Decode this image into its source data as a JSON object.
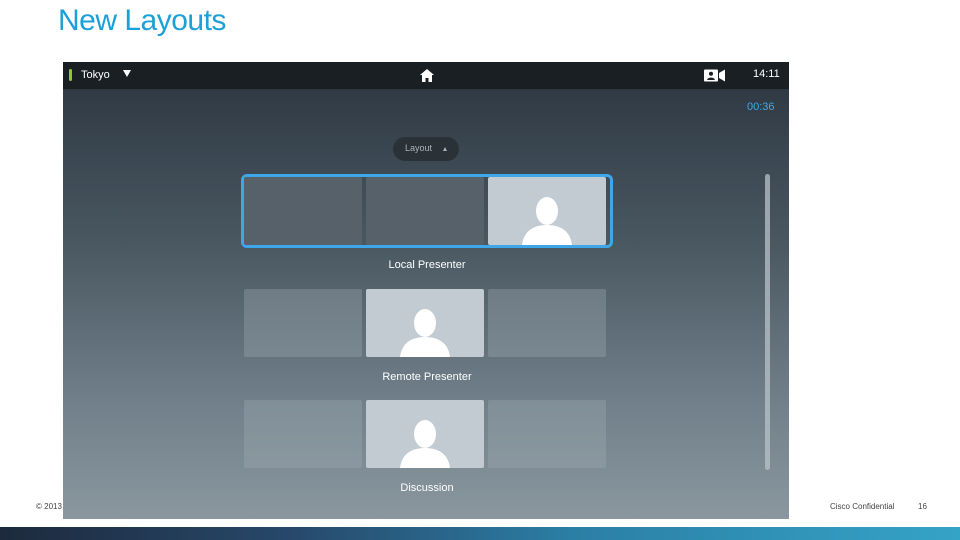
{
  "slide": {
    "title": "New Layouts",
    "footer_copyright": "© 2013",
    "footer_confidential": "Cisco Confidential",
    "page_number": "16"
  },
  "device": {
    "topbar": {
      "site_name": "Tokyo",
      "clock": "14:11",
      "icons": [
        "status-led",
        "dropdown-caret",
        "home-icon",
        "camera-icon"
      ]
    },
    "call_timer": "00:36",
    "layout_button": {
      "label": "Layout"
    },
    "layout_options": [
      {
        "label": "Local Presenter",
        "selected": true
      },
      {
        "label": "Remote Presenter",
        "selected": false
      },
      {
        "label": "Discussion",
        "selected": false
      }
    ]
  },
  "colors": {
    "title": "#1ba0d7",
    "selection": "#3ea7ea",
    "status_led": "#8bc83a",
    "timer": "#3ea7ea"
  }
}
